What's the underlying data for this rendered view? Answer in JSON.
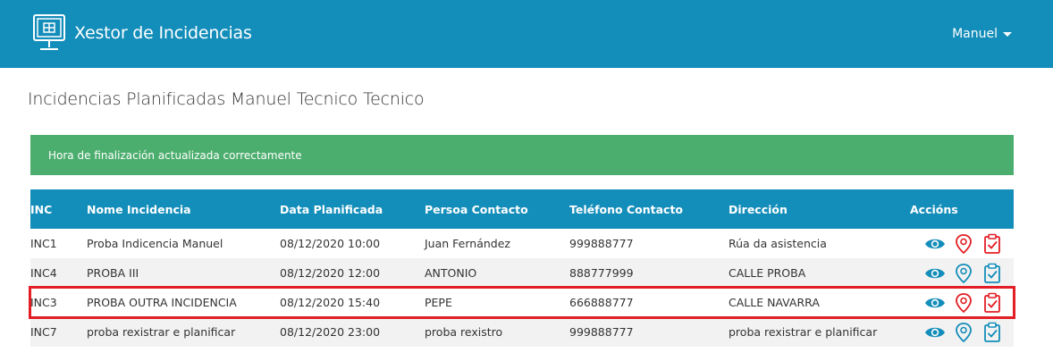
{
  "app": {
    "title": "Xestor de Incidencias",
    "user_menu_label": "Manuel"
  },
  "page": {
    "title": "Incidencias Planificadas Manuel Tecnico Tecnico"
  },
  "alert": {
    "message": "Hora de finalización actualizada correctamente"
  },
  "table": {
    "headers": {
      "inc": "INC",
      "name": "Nome Incidencia",
      "date": "Data Planificada",
      "person": "Persoa Contacto",
      "phone": "Teléfono Contacto",
      "address": "Dirección",
      "actions": "Accións"
    },
    "rows": [
      {
        "inc": "INC1",
        "name": "Proba Indicencia Manuel",
        "date": "08/12/2020 10:00",
        "person": "Juan Fernández",
        "phone": "999888777",
        "address": "Rúa da asistencia",
        "highlighted": false
      },
      {
        "inc": "INC4",
        "name": "PROBA III",
        "date": "08/12/2020 12:00",
        "person": "ANTONIO",
        "phone": "888777999",
        "address": "CALLE PROBA",
        "highlighted": false
      },
      {
        "inc": "INC3",
        "name": "PROBA OUTRA INCIDENCIA",
        "date": "08/12/2020 15:40",
        "person": "PEPE",
        "phone": "666888777",
        "address": "CALLE NAVARRA",
        "highlighted": true
      },
      {
        "inc": "INC7",
        "name": "proba rexistrar e planificar",
        "date": "08/12/2020 23:00",
        "person": "proba rexistro",
        "phone": "999888777",
        "address": "proba rexistrar e planificar",
        "highlighted": false
      }
    ],
    "action_icons": [
      "eye-icon",
      "map-pin-icon",
      "clipboard-check-icon"
    ]
  },
  "colors": {
    "navbar": "#138db9",
    "alert_success": "#4cae6e",
    "row_highlight": "#e31e24",
    "icon_blue": "#138db9",
    "icon_red": "#e31e24"
  }
}
